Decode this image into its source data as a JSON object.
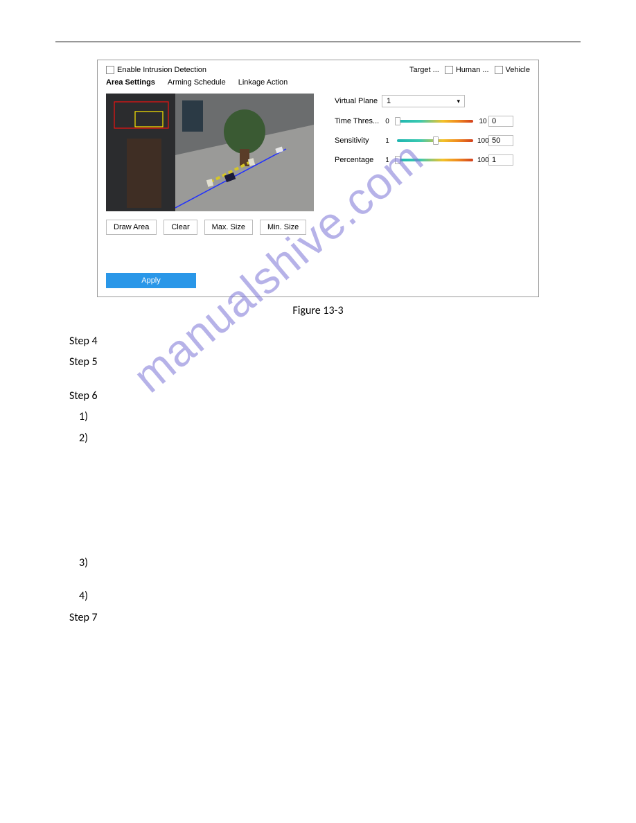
{
  "panel": {
    "enable_label": "Enable Intrusion Detection",
    "target_label": "Target ...",
    "human_label": "Human ...",
    "vehicle_label": "Vehicle",
    "tabs": {
      "area": "Area Settings",
      "arming": "Arming Schedule",
      "linkage": "Linkage Action"
    },
    "buttons": {
      "draw": "Draw Area",
      "clear": "Clear",
      "max": "Max. Size",
      "min": "Min. Size",
      "apply": "Apply"
    },
    "params": {
      "virtual_plane_label": "Virtual Plane",
      "virtual_plane_value": "1",
      "time_label": "Time Thres...",
      "time_min": "0",
      "time_max": "10",
      "time_value": "0",
      "sens_label": "Sensitivity",
      "sens_min": "1",
      "sens_max": "100",
      "sens_value": "50",
      "perc_label": "Percentage",
      "perc_min": "1",
      "perc_max": "100",
      "perc_value": "1"
    }
  },
  "caption": "Figure 13-3",
  "steps": {
    "s4": "Step 4",
    "s5": "Step 5",
    "s6": "Step 6",
    "s6_1": "1)",
    "s6_2": "2)",
    "s6_3": "3)",
    "s6_4": "4)",
    "s7": "Step 7"
  },
  "watermark": "manualshive.com"
}
